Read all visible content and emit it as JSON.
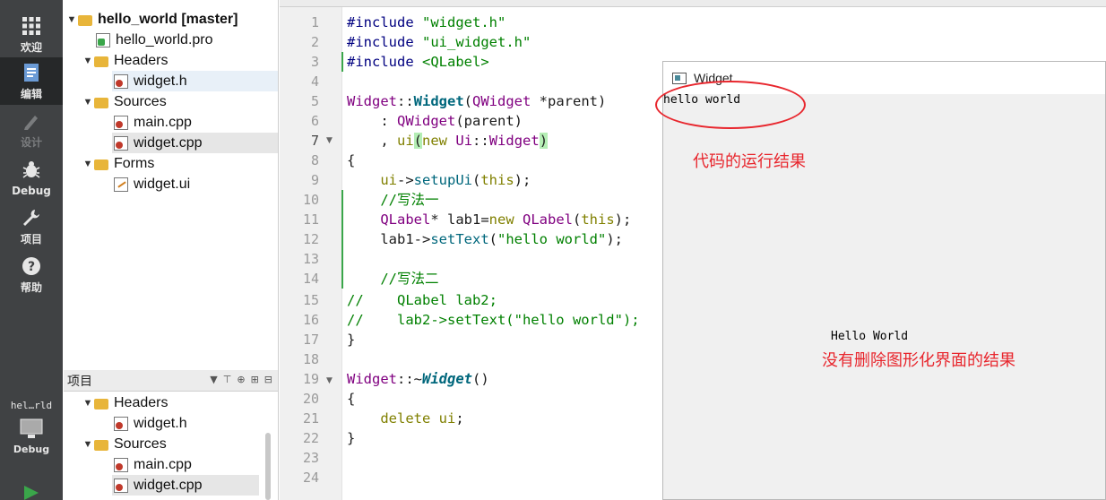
{
  "modebar": {
    "items": [
      {
        "label": "欢迎",
        "icon": "grid-icon"
      },
      {
        "label": "编辑",
        "icon": "edit-document-icon"
      },
      {
        "label": "设计",
        "icon": "pencil-icon"
      },
      {
        "label": "Debug",
        "icon": "bug-icon"
      },
      {
        "label": "项目",
        "icon": "wrench-icon"
      },
      {
        "label": "帮助",
        "icon": "help-icon"
      }
    ],
    "kit_name": "hel…rld",
    "kit_mode": "Debug"
  },
  "project_tree": {
    "root": "hello_world [master]",
    "pro_file": "hello_world.pro",
    "headers_label": "Headers",
    "header_file": "widget.h",
    "sources_label": "Sources",
    "source_main": "main.cpp",
    "source_widget": "widget.cpp",
    "forms_label": "Forms",
    "form_file": "widget.ui"
  },
  "open_docs": {
    "header_title": "项目",
    "headers_label": "Headers",
    "header_file": "widget.h",
    "sources_label": "Sources",
    "source_main": "main.cpp",
    "source_widget": "widget.cpp"
  },
  "editor": {
    "line_numbers": [
      "1",
      "2",
      "3",
      "4",
      "5",
      "6",
      "7",
      "8",
      "9",
      "10",
      "11",
      "12",
      "13",
      "14",
      "15",
      "16",
      "17",
      "18",
      "19",
      "20",
      "21",
      "22",
      "23",
      "24"
    ],
    "current_line": 7
  },
  "widget_window": {
    "title": "Widget",
    "label_new": "hello world",
    "label_designer": "Hello World"
  },
  "annotations": {
    "run_result": "代码的运行结果",
    "designer_result": "没有删除图形化界面的结果"
  },
  "colors": {
    "annotation_red": "#e8262d",
    "modebar_bg": "#404244",
    "preprocessor_blue": "#000080",
    "string_green": "#008000",
    "type_purple": "#800080"
  }
}
